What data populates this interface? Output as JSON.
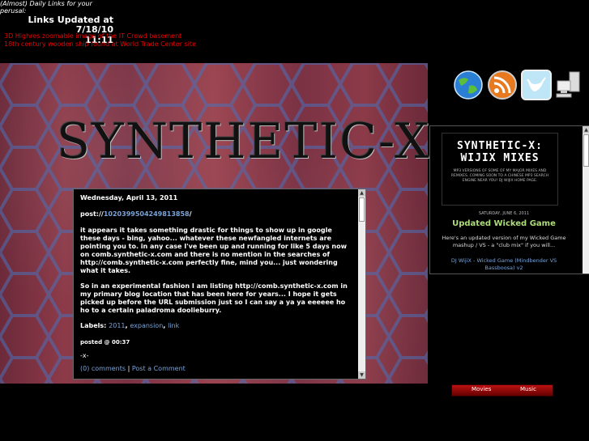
{
  "header": {
    "perusal": "(Almost) Daily Links for your perusal:",
    "updated": "Links Updated at 7/18/10",
    "time": "11:11"
  },
  "links": [
    "3D Highres zoomable image of the IT Crowd basement",
    "18th century wooden ship found at World Trade Center site"
  ],
  "banner": "SYNTHETIC-X",
  "post": {
    "date": "Wednesday, April 13, 2011",
    "title_prefix": "post://",
    "title_link": "1020399504249813858",
    "title_suffix": "/",
    "paragraph1": "it appears it takes something drastic for things to show up in google these days - bing, yahoo... whatever these newfangled internets are pointing you to. in any case I've been up and running for like 5 days now on comb.synthetic-x.com and there is no mention in the searches of http://comb.synthetic-x.com perfectly fine, mind you... just wondering what it takes.",
    "paragraph2": "So in an experimental fashion I am listing http://comb.synthetic-x.com in my primary blog location that has been here for years... I hope it gets picked up before the URL submission just so I can say a ya ya eeeeee ho ho to a certain paladroma doolieburry.",
    "labels_heading": "Labels:",
    "labels": [
      "2011",
      "expansion",
      "link"
    ],
    "posted": "posted @ 00:37",
    "signature": "-x-",
    "comments": "(0) comments",
    "separator": "|",
    "post_comment": "Post a Comment"
  },
  "icons": [
    "globe-icon",
    "rss-icon",
    "twitter-bird-icon",
    "network-computer-icon"
  ],
  "widget": {
    "title": "SYNTHETIC-X: WIJIX MIXES",
    "subtitle": "MP3 VERSIONS OF SOME OF MY MAJOR MIXES AND REMIXES. COMING SOON TO A CHINESE MP3 SEARCH ENGINE NEAR YOU! DJ WIJIX HOME PAGE.",
    "date": "SATURDAY, JUNE 6, 2011",
    "post_title": "Updated Wicked Game",
    "text": "Here's an updated version of my Wicked Game mashup / VS - a \"club mix\" if you will...",
    "link": "DJ WijiX - Wicked Game (Mindbender VS Bassboosa) v2"
  },
  "tabs": [
    "Movies",
    "Music"
  ]
}
